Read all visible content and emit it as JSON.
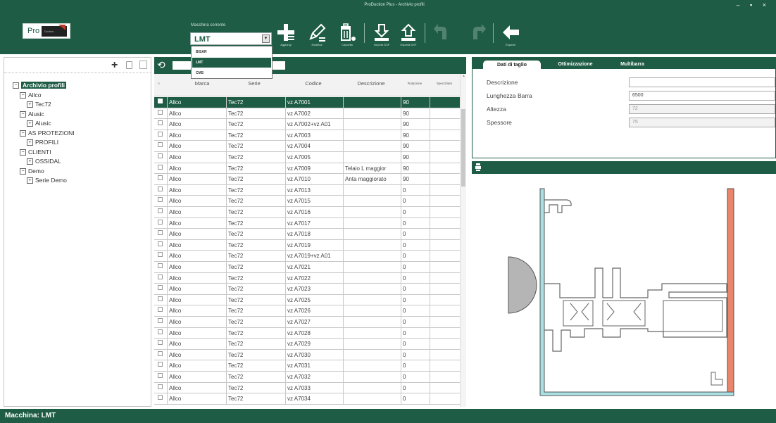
{
  "window": {
    "title": "ProDuction Plus - Archivio profili",
    "controls": "– ▪ ×"
  },
  "logo": {
    "text": "Pro",
    "subtext": "Duction"
  },
  "machine": {
    "label": "Macchina corrente",
    "selected": "LMT",
    "options": [
      "BISAR",
      "LMT",
      "CMS"
    ]
  },
  "toolbar": {
    "buttons": [
      {
        "name": "add",
        "label": "Aggiungi",
        "icon": "plus-icon",
        "enabled": true
      },
      {
        "name": "edit",
        "label": "Modifica",
        "icon": "pencil-icon",
        "enabled": true
      },
      {
        "name": "delete",
        "label": "Cancella",
        "icon": "trash-icon",
        "enabled": true
      },
      {
        "name": "import",
        "label": "Importa DXF",
        "icon": "download-icon",
        "enabled": true
      },
      {
        "name": "export",
        "label": "Esporta DXF",
        "icon": "upload-icon",
        "enabled": true
      },
      {
        "name": "undo",
        "label": "",
        "icon": "undo-icon",
        "enabled": false
      },
      {
        "name": "redo",
        "label": "",
        "icon": "redo-icon",
        "enabled": false
      },
      {
        "name": "exit",
        "label": "Esporta",
        "icon": "arrow-left-icon",
        "enabled": true
      }
    ]
  },
  "tree": {
    "nodes": [
      {
        "label": "Archivio profili",
        "level": 0,
        "toggle": "−",
        "root": true
      },
      {
        "label": "Allco",
        "level": 1,
        "toggle": "−"
      },
      {
        "label": "Tec72",
        "level": 2,
        "toggle": "+"
      },
      {
        "label": "Alusic",
        "level": 1,
        "toggle": "−"
      },
      {
        "label": "Alusic",
        "level": 2,
        "toggle": "+"
      },
      {
        "label": "AS PROTEZIONI",
        "level": 1,
        "toggle": "−"
      },
      {
        "label": "PROFILI",
        "level": 2,
        "toggle": "+"
      },
      {
        "label": "CLIENTI",
        "level": 1,
        "toggle": "−"
      },
      {
        "label": "OSSIDAL",
        "level": 2,
        "toggle": "+"
      },
      {
        "label": "Demo",
        "level": 1,
        "toggle": "−"
      },
      {
        "label": "Serie Demo",
        "level": 2,
        "toggle": "+"
      }
    ]
  },
  "table": {
    "columns": [
      "Marca",
      "Serie",
      "Codice",
      "Descrizione",
      "Rotazione",
      "Specchiato"
    ],
    "rows": [
      {
        "marca": "Allco",
        "serie": "Tec72",
        "codice": "vz A7001",
        "descrizione": "",
        "rotazione": "90",
        "selected": true
      },
      {
        "marca": "Allco",
        "serie": "Tec72",
        "codice": "vz A7002",
        "descrizione": "",
        "rotazione": "90"
      },
      {
        "marca": "Allco",
        "serie": "Tec72",
        "codice": "vz A7002+vz A01",
        "descrizione": "",
        "rotazione": "90"
      },
      {
        "marca": "Allco",
        "serie": "Tec72",
        "codice": "vz A7003",
        "descrizione": "",
        "rotazione": "90"
      },
      {
        "marca": "Allco",
        "serie": "Tec72",
        "codice": "vz A7004",
        "descrizione": "",
        "rotazione": "90"
      },
      {
        "marca": "Allco",
        "serie": "Tec72",
        "codice": "vz A7005",
        "descrizione": "",
        "rotazione": "90"
      },
      {
        "marca": "Allco",
        "serie": "Tec72",
        "codice": "vz A7009",
        "descrizione": "Telaio L maggior",
        "rotazione": "90"
      },
      {
        "marca": "Allco",
        "serie": "Tec72",
        "codice": "vz A7010",
        "descrizione": "Anta maggiorato",
        "rotazione": "90"
      },
      {
        "marca": "Allco",
        "serie": "Tec72",
        "codice": "vz A7013",
        "descrizione": "",
        "rotazione": "0"
      },
      {
        "marca": "Allco",
        "serie": "Tec72",
        "codice": "vz A7015",
        "descrizione": "",
        "rotazione": "0"
      },
      {
        "marca": "Allco",
        "serie": "Tec72",
        "codice": "vz A7016",
        "descrizione": "",
        "rotazione": "0"
      },
      {
        "marca": "Allco",
        "serie": "Tec72",
        "codice": "vz A7017",
        "descrizione": "",
        "rotazione": "0"
      },
      {
        "marca": "Allco",
        "serie": "Tec72",
        "codice": "vz A7018",
        "descrizione": "",
        "rotazione": "0"
      },
      {
        "marca": "Allco",
        "serie": "Tec72",
        "codice": "vz A7019",
        "descrizione": "",
        "rotazione": "0"
      },
      {
        "marca": "Allco",
        "serie": "Tec72",
        "codice": "vz A7019+vz A01",
        "descrizione": "",
        "rotazione": "0"
      },
      {
        "marca": "Allco",
        "serie": "Tec72",
        "codice": "vz A7021",
        "descrizione": "",
        "rotazione": "0"
      },
      {
        "marca": "Allco",
        "serie": "Tec72",
        "codice": "vz A7022",
        "descrizione": "",
        "rotazione": "0"
      },
      {
        "marca": "Allco",
        "serie": "Tec72",
        "codice": "vz A7023",
        "descrizione": "",
        "rotazione": "0"
      },
      {
        "marca": "Allco",
        "serie": "Tec72",
        "codice": "vz A7025",
        "descrizione": "",
        "rotazione": "0"
      },
      {
        "marca": "Allco",
        "serie": "Tec72",
        "codice": "vz A7026",
        "descrizione": "",
        "rotazione": "0"
      },
      {
        "marca": "Allco",
        "serie": "Tec72",
        "codice": "vz A7027",
        "descrizione": "",
        "rotazione": "0"
      },
      {
        "marca": "Allco",
        "serie": "Tec72",
        "codice": "vz A7028",
        "descrizione": "",
        "rotazione": "0"
      },
      {
        "marca": "Allco",
        "serie": "Tec72",
        "codice": "vz A7029",
        "descrizione": "",
        "rotazione": "0"
      },
      {
        "marca": "Allco",
        "serie": "Tec72",
        "codice": "vz A7030",
        "descrizione": "",
        "rotazione": "0"
      },
      {
        "marca": "Allco",
        "serie": "Tec72",
        "codice": "vz A7031",
        "descrizione": "",
        "rotazione": "0"
      },
      {
        "marca": "Allco",
        "serie": "Tec72",
        "codice": "vz A7032",
        "descrizione": "",
        "rotazione": "0"
      },
      {
        "marca": "Allco",
        "serie": "Tec72",
        "codice": "vz A7033",
        "descrizione": "",
        "rotazione": "0"
      },
      {
        "marca": "Allco",
        "serie": "Tec72",
        "codice": "vz A7034",
        "descrizione": "",
        "rotazione": "0"
      }
    ]
  },
  "properties": {
    "tabs": [
      "Dati di taglio",
      "Ottimizzazione",
      "Multibarra"
    ],
    "active_tab": 0,
    "fields": [
      {
        "label": "Descrizione",
        "value": "",
        "readonly": false
      },
      {
        "label": "Lunghezza Barra",
        "value": "6500",
        "readonly": false
      },
      {
        "label": "Altezza",
        "value": "72",
        "readonly": true
      },
      {
        "label": "Spessore",
        "value": "75",
        "readonly": true
      }
    ]
  },
  "status": {
    "text": "Macchina: LMT"
  },
  "colors": {
    "accent": "#1e5c46",
    "clamp_left": "#a8dfe3",
    "clamp_right": "#e8856a"
  }
}
